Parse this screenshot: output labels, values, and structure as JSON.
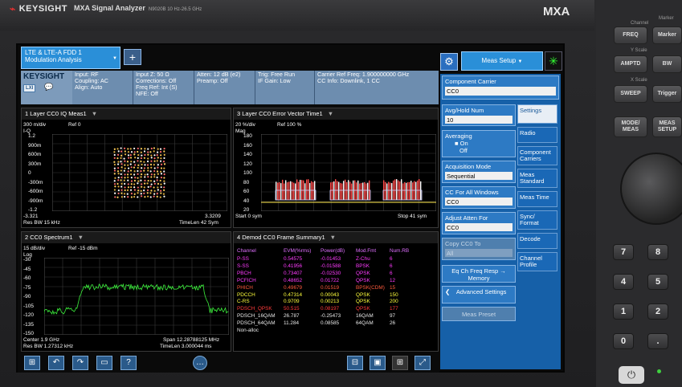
{
  "brand": {
    "name": "KEYSIGHT",
    "model": "MXA Signal Analyzer",
    "model_small": "N9020B  10 Hz-26.5 GHz",
    "logo_text": "MXA"
  },
  "hw": {
    "hdr_channel": "Channel",
    "hdr_marker": "Marker",
    "freq": "FREQ",
    "marker": "Marker",
    "hdr_yscale": "Y Scale",
    "amptd": "AMPTD",
    "bw": "BW",
    "hdr_xscale": "X Scale",
    "sweep": "SWEEP",
    "trigger": "Trigger",
    "mode_meas": "MODE/\nMEAS",
    "meas_setup": "MEAS\nSETUP",
    "keys": [
      "7",
      "8",
      "4",
      "5",
      "1",
      "2",
      "0",
      "."
    ],
    "power": "⏻"
  },
  "screen": {
    "mode_tab": {
      "line1": "LTE & LTE-A FDD 1",
      "line2": "Modulation Analysis"
    },
    "plus": "+",
    "meas_setup": "Meas Setup",
    "info": {
      "logo": "KEYSIGHT",
      "lxi": "LXI",
      "b1": [
        "Input: RF",
        "Coupling: AC",
        "Align: Auto"
      ],
      "b2": [
        "Input Z: 50 Ω",
        "Corrections: Off",
        "Freq Ref: Int (S)",
        "NFE: Off"
      ],
      "b3": [
        "Atten: 12 dB (e2)",
        "Preamp: Off"
      ],
      "b4": [
        "Trig: Free Run",
        "IF Gain: Low"
      ],
      "b5": [
        "Carrier Ref Freq: 1.900000000 GHz",
        "CC Info: Downlink, 1 CC"
      ]
    },
    "w1": {
      "title": "1 Layer CC0 IQ Meas1",
      "scale": "300 m/div",
      "ref": "Ref 0",
      "unit": "I-Q",
      "yticks": [
        "1.2",
        "900m",
        "600m",
        "300m",
        "0",
        "-300m",
        "-600m",
        "-900m",
        "-1.2"
      ],
      "xleft": "-3.321",
      "xright": "3.3209",
      "bw": "Res BW 15 kHz",
      "timelen": "TimeLen 42  Sym"
    },
    "w2": {
      "title": "3 Layer CC0 Error Vector Time1",
      "scale": "20  %/div",
      "ref": "Ref 100  %",
      "unit": "Mag",
      "yticks": [
        "180",
        "160",
        "140",
        "120",
        "100",
        "80",
        "60",
        "40",
        "20"
      ],
      "start": "Start 0  sym",
      "stop": "Stop 41  sym"
    },
    "w3": {
      "title": "2 CC0 Spectrum1",
      "scale": "15 dB/div",
      "ref": "Ref -15 dBm",
      "unit": "Log",
      "yticks": [
        "-30",
        "-45",
        "-60",
        "-75",
        "-90",
        "-105",
        "-120",
        "-135",
        "-150"
      ],
      "center": "Center 1.9 GHz",
      "bw": "Res BW 1.27312 kHz",
      "span": "Span 12.28788125 MHz",
      "timelen": "TimeLen 3.000044 ms"
    },
    "w4": {
      "title": "4 Demod CC0 Frame Summary1",
      "headers": [
        "Channel",
        "EVM(%rms)",
        "Power(dB)",
        "Mod.Fmt",
        "Num.RB"
      ],
      "rows": [
        {
          "c": "P-SS",
          "e": "0.54575",
          "p": "-0.01453",
          "m": "Z-Chu",
          "n": "6",
          "color": "#ff3bff"
        },
        {
          "c": "S-SS",
          "e": "0.41956",
          "p": "-0.01588",
          "m": "BPSK",
          "n": "6",
          "color": "#ff3bff"
        },
        {
          "c": "PBCH",
          "e": "0.73407",
          "p": "-0.02530",
          "m": "QPSK",
          "n": "6",
          "color": "#ff3bff"
        },
        {
          "c": "PCFICH",
          "e": "0.48652",
          "p": "0.01722",
          "m": "QPSK",
          "n": "12",
          "color": "#ff3bff"
        },
        {
          "c": "PHICH",
          "e": "0.49679",
          "p": "0.01519",
          "m": "BPSK(CDM)",
          "n": "15",
          "color": "#ff5a3c"
        },
        {
          "c": "PDCCH",
          "e": "0.47314",
          "p": "0.00043",
          "m": "QPSK",
          "n": "150",
          "color": "#ffff3c"
        },
        {
          "c": "C-RS",
          "e": "0.9709",
          "p": "0.00213",
          "m": "QPSK",
          "n": "200",
          "color": "#ffff3c"
        },
        {
          "c": "PDSCH_QPSK",
          "e": "50.515",
          "p": "0.08197",
          "m": "QPSK",
          "n": "177",
          "color": "#ff3b3b"
        },
        {
          "c": "PDSCH_16QAM",
          "e": "26.787",
          "p": "-0.25473",
          "m": "16QAM",
          "n": "97",
          "color": "#e8e8e8"
        },
        {
          "c": "PDSCH_64QAM",
          "e": "11.284",
          "p": "0.08585",
          "m": "64QAM",
          "n": "26",
          "color": "#e8e8e8"
        },
        {
          "c": "Non-alloc",
          "e": "",
          "p": "",
          "m": "",
          "n": "",
          "color": "#e8e8e8"
        }
      ]
    },
    "panel": {
      "cc_label": "Component Carrier",
      "cc_value": "CC0",
      "avg_label": "Avg/Hold Num",
      "avg_value": "10",
      "averaging": "Averaging",
      "on": "On",
      "off": "Off",
      "acq_label": "Acquisition Mode",
      "acq_value": "Sequential",
      "ccall_label": "CC For All Windows",
      "ccall_value": "CC0",
      "adj_label": "Adjust Atten For",
      "adj_value": "CC0",
      "copy_label": "Copy CC0 To",
      "copy_value": "All",
      "eq": "Eq Ch Freq Resp → Memory",
      "adv": "Advanced Settings",
      "preset": "Meas Preset",
      "tabs": [
        "Settings",
        "Radio",
        "Component Carriers",
        "Meas Standard",
        "Meas Time",
        "Sync/ Format",
        "Decode",
        "Channel Profile"
      ]
    }
  }
}
